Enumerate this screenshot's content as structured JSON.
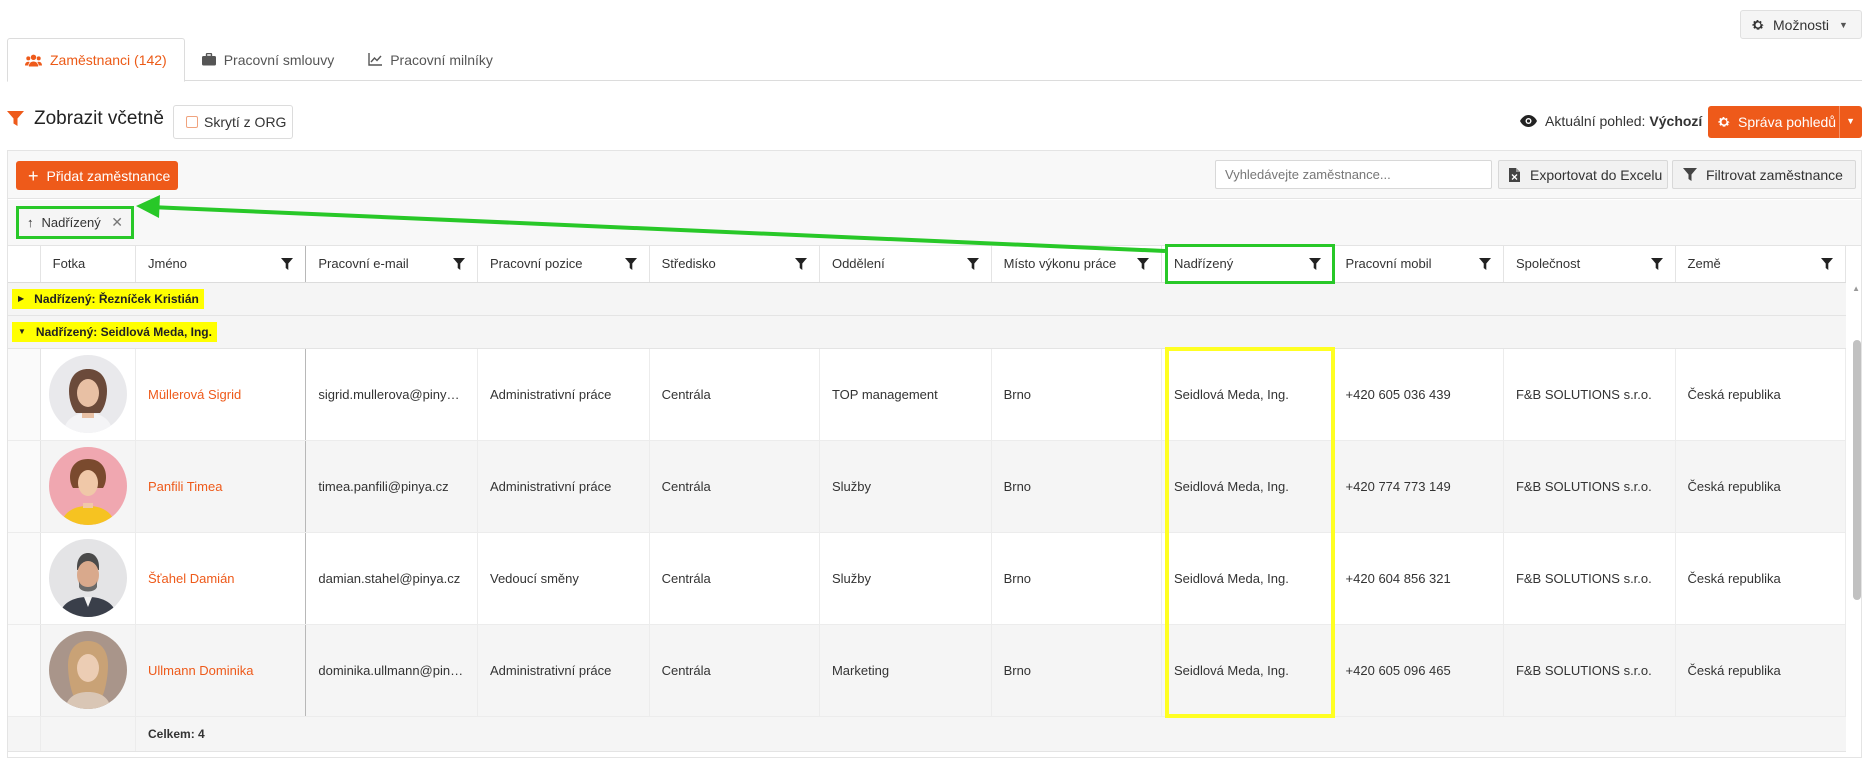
{
  "header": {
    "options_label": "Možnosti"
  },
  "tabs": [
    {
      "label": "Zaměstnanci (142)",
      "icon": "users-icon",
      "active": true
    },
    {
      "label": "Pracovní smlouvy",
      "icon": "briefcase-icon",
      "active": false
    },
    {
      "label": "Pracovní milníky",
      "icon": "chart-line-icon",
      "active": false
    }
  ],
  "filter_bar": {
    "title": "Zobrazit včetně",
    "hidden_toggle_label": "Skrytí z ORG",
    "current_view_label": "Aktuální pohled:",
    "current_view_value": "Výchozí",
    "manage_views_label": "Správa pohledů"
  },
  "toolbar": {
    "add_employee_label": "Přidat zaměstnance",
    "search_placeholder": "Vyhledávejte zaměstnance...",
    "export_label": "Exportovat do Excelu",
    "filter_label": "Filtrovat zaměstnance"
  },
  "grouping": {
    "chip_label": "Nadřízený"
  },
  "table": {
    "columns": [
      "Fotka",
      "Jméno",
      "Pracovní e-mail",
      "Pracovní pozice",
      "Středisko",
      "Oddělení",
      "Místo výkonu práce",
      "Nadřízený",
      "Pracovní mobil",
      "Společnost",
      "Země"
    ],
    "groups": [
      {
        "label": "Nadřízený: Řezníček Kristián",
        "expanded": false
      },
      {
        "label": "Nadřízený: Seidlová Meda, Ing.",
        "expanded": true
      }
    ],
    "rows": [
      {
        "name": "Müllerová Sigrid",
        "email": "sigrid.mullerova@pinya.cz",
        "position": "Administrativní práce",
        "center": "Centrála",
        "department": "TOP management",
        "workplace": "Brno",
        "manager": "Seidlová Meda, Ing.",
        "mobile": "+420 605 036 439",
        "company": "F&B SOLUTIONS s.r.o.",
        "country": "Česká republika"
      },
      {
        "name": "Panfili Timea",
        "email": "timea.panfili@pinya.cz",
        "position": "Administrativní práce",
        "center": "Centrála",
        "department": "Služby",
        "workplace": "Brno",
        "manager": "Seidlová Meda, Ing.",
        "mobile": "+420 774 773 149",
        "company": "F&B SOLUTIONS s.r.o.",
        "country": "Česká republika"
      },
      {
        "name": "Šťahel Damián",
        "email": "damian.stahel@pinya.cz",
        "position": "Vedoucí směny",
        "center": "Centrála",
        "department": "Služby",
        "workplace": "Brno",
        "manager": "Seidlová Meda, Ing.",
        "mobile": "+420 604 856 321",
        "company": "F&B SOLUTIONS s.r.o.",
        "country": "Česká republika"
      },
      {
        "name": "Ullmann Dominika",
        "email": "dominika.ullmann@pinya.cz",
        "position": "Administrativní práce",
        "center": "Centrála",
        "department": "Marketing",
        "workplace": "Brno",
        "manager": "Seidlová Meda, Ing.",
        "mobile": "+420 605 096 465",
        "company": "F&B SOLUTIONS s.r.o.",
        "country": "Česká republika"
      }
    ],
    "total_label": "Celkem: 4"
  },
  "colors": {
    "accent": "#ee5a1a",
    "group_highlight": "#ffff00",
    "annotation_green": "#28c828",
    "annotation_yellow": "#ffff22"
  }
}
